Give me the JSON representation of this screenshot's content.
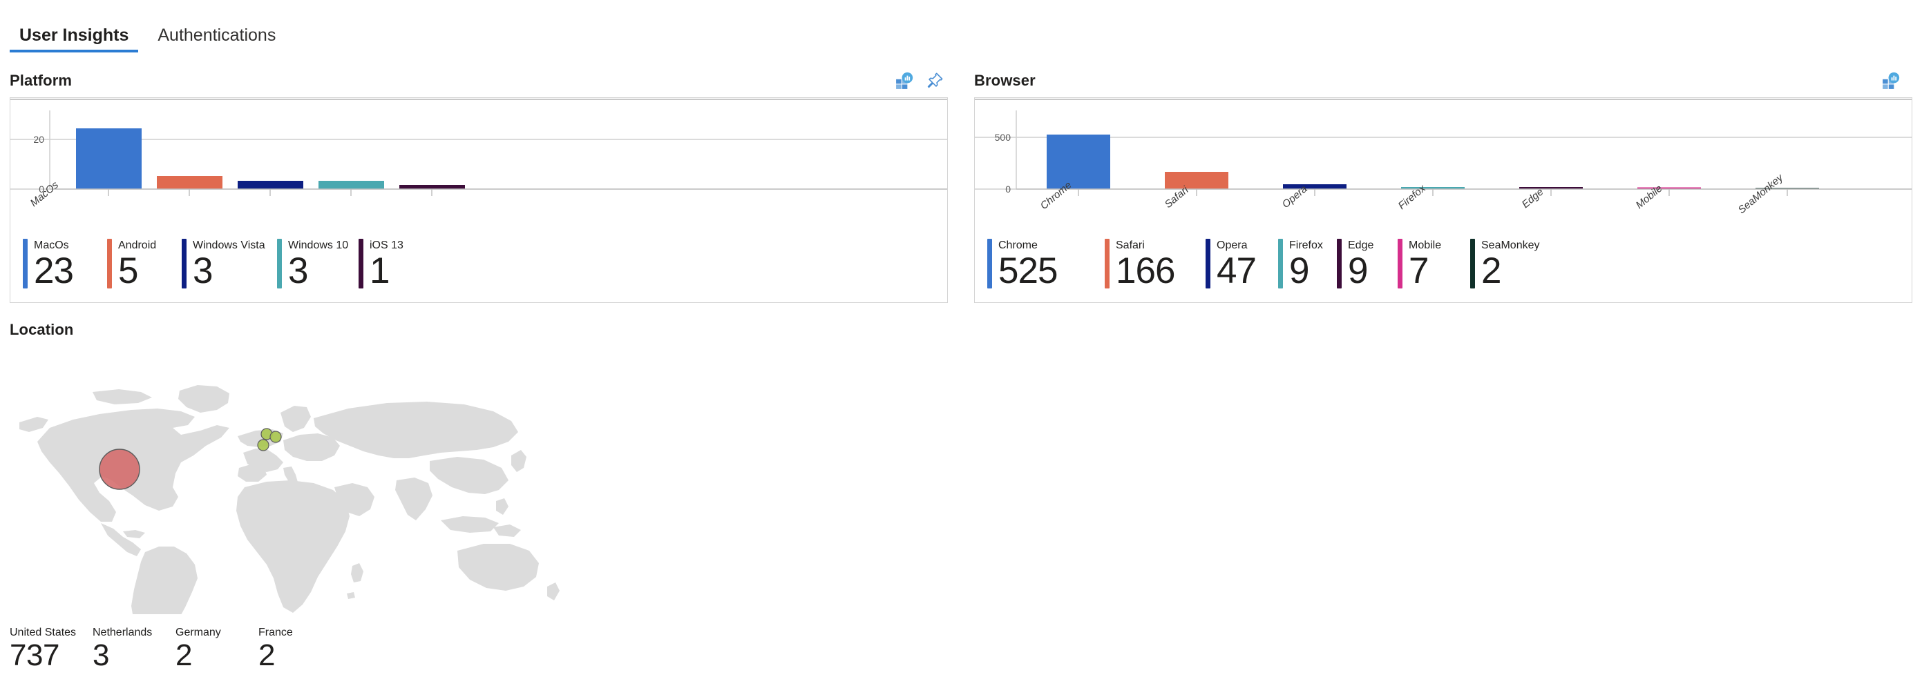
{
  "tabs": [
    {
      "label": "User Insights",
      "active": true
    },
    {
      "label": "Authentications",
      "active": false
    }
  ],
  "colors": {
    "accent": "#2b7cd3",
    "bar_blue": "#3a76ce",
    "bar_orange": "#e06a4f",
    "bar_navy": "#0d1f83",
    "bar_teal": "#4aa8b0",
    "bar_plum": "#3d0d3a",
    "bar_magenta": "#d62f8c",
    "bar_darkgreen": "#0f3029",
    "map_land": "#dddddd",
    "bubble_red": "#d46a6a",
    "bubble_green": "#a2c council",
    "panel_border": "#d4d4d4"
  },
  "platform": {
    "title": "Platform",
    "icons": [
      {
        "name": "view-insights-icon"
      },
      {
        "name": "pin-icon"
      }
    ],
    "kpis": [
      {
        "label": "MacOs",
        "value": "23",
        "color": "#3a76ce"
      },
      {
        "label": "Android",
        "value": "5",
        "color": "#e06a4f"
      },
      {
        "label": "Windows Vista",
        "value": "3",
        "color": "#0d1f83"
      },
      {
        "label": "Windows 10",
        "value": "3",
        "color": "#4aa8b0"
      },
      {
        "label": "iOS 13",
        "value": "1",
        "color": "#3d0d3a"
      }
    ],
    "chart_data": {
      "type": "bar",
      "title": "Platform",
      "categories": [
        "MacOs",
        "Android",
        "Windows Vista",
        "Windows 10",
        "iOS 13"
      ],
      "values": [
        23,
        5,
        3,
        3,
        1
      ],
      "colors": [
        "#3a76ce",
        "#e06a4f",
        "#0d1f83",
        "#4aa8b0",
        "#3d0d3a"
      ],
      "visible_tick_labels": [
        "MacOs"
      ],
      "xlabel": "",
      "ylabel": "",
      "yticks": [
        0,
        20
      ],
      "ylim": [
        0,
        27
      ],
      "grid": true,
      "legend": "below-as-kpi-strip"
    }
  },
  "browser": {
    "title": "Browser",
    "icons": [
      {
        "name": "view-insights-icon"
      }
    ],
    "kpis": [
      {
        "label": "Chrome",
        "value": "525",
        "color": "#3a76ce"
      },
      {
        "label": "Safari",
        "value": "166",
        "color": "#e06a4f"
      },
      {
        "label": "Opera",
        "value": "47",
        "color": "#0d1f83"
      },
      {
        "label": "Firefox",
        "value": "9",
        "color": "#4aa8b0"
      },
      {
        "label": "Edge",
        "value": "9",
        "color": "#3d0d3a"
      },
      {
        "label": "Mobile",
        "value": "7",
        "color": "#d62f8c"
      },
      {
        "label": "SeaMonkey",
        "value": "2",
        "color": "#0f3029"
      }
    ],
    "chart_data": {
      "type": "bar",
      "title": "Browser",
      "categories": [
        "Chrome",
        "Safari",
        "Opera",
        "Firefox",
        "Edge",
        "Mobile",
        "SeaMonkey"
      ],
      "values": [
        525,
        166,
        47,
        9,
        9,
        7,
        2
      ],
      "colors": [
        "#3a76ce",
        "#e06a4f",
        "#0d1f83",
        "#4aa8b0",
        "#3d0d3a",
        "#d62f8c",
        "#0f3029"
      ],
      "visible_tick_labels": [
        "Chrome",
        "Safari",
        "Opera",
        "Firefox",
        "Edge",
        "Mobile",
        "SeaMonkey"
      ],
      "xlabel": "",
      "ylabel": "",
      "yticks": [
        0,
        500
      ],
      "ylim": [
        0,
        600
      ],
      "grid": true,
      "legend": "below-as-kpi-strip"
    }
  },
  "location": {
    "title": "Location",
    "kpis": [
      {
        "label": "United States",
        "value": "737"
      },
      {
        "label": "Netherlands",
        "value": "3"
      },
      {
        "label": "Germany",
        "value": "2"
      },
      {
        "label": "France",
        "value": "2"
      }
    ],
    "chart_data": {
      "type": "bubble-map",
      "title": "Location",
      "categories": [
        "United States",
        "Netherlands",
        "Germany",
        "France"
      ],
      "values": [
        737,
        3,
        2,
        2
      ],
      "bubbles": [
        {
          "country": "United States",
          "value": 737,
          "color": "#d46a6a",
          "radius_px": 29
        },
        {
          "country": "Netherlands",
          "value": 3,
          "color": "#a9c64e",
          "radius_px": 8
        },
        {
          "country": "Germany",
          "value": 2,
          "color": "#a9c64e",
          "radius_px": 8
        },
        {
          "country": "France",
          "value": 2,
          "color": "#a9c64e",
          "radius_px": 8
        }
      ]
    }
  }
}
